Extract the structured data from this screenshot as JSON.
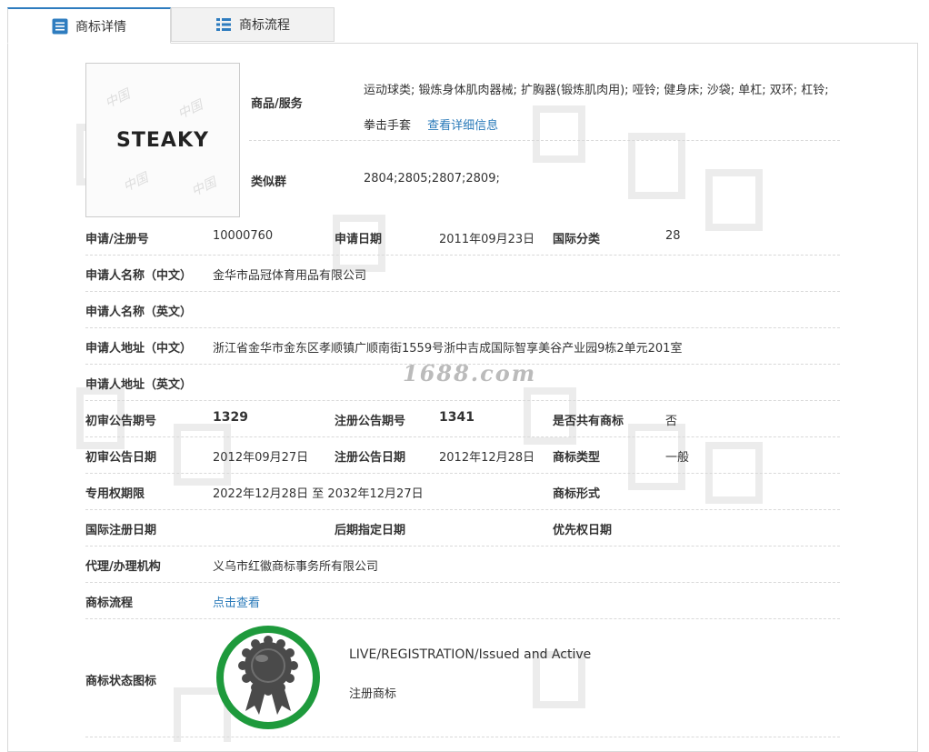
{
  "tabs": [
    {
      "label": "商标详情",
      "icon": "list-icon",
      "active": true
    },
    {
      "label": "商标流程",
      "icon": "grid-list-icon",
      "active": false
    }
  ],
  "logo": {
    "text": "STEAKY"
  },
  "goods": {
    "label": "商品/服务",
    "text": "运动球类; 锻炼身体肌肉器械; 扩胸器(锻炼肌肉用); 哑铃; 健身床; 沙袋; 单杠; 双环; 杠铃; 拳击手套",
    "link": "查看详细信息"
  },
  "similar_group": {
    "label": "类似群",
    "value": "2804;2805;2807;2809;"
  },
  "rows": {
    "reg_no": {
      "label": "申请/注册号",
      "value": "10000760"
    },
    "apply_date": {
      "label": "申请日期",
      "value": "2011年09月23日"
    },
    "intl_class": {
      "label": "国际分类",
      "value": "28"
    },
    "applicant_cn": {
      "label": "申请人名称（中文）",
      "value": "金华市品冠体育用品有限公司"
    },
    "applicant_en": {
      "label": "申请人名称（英文）",
      "value": ""
    },
    "address_cn": {
      "label": "申请人地址（中文）",
      "value": "浙江省金华市金东区孝顺镇广顺南街1559号浙中吉成国际智享美谷产业园9栋2单元201室"
    },
    "address_en": {
      "label": "申请人地址（英文）",
      "value": ""
    },
    "prelim_no": {
      "label": "初审公告期号",
      "value": "1329"
    },
    "reg_pub_no": {
      "label": "注册公告期号",
      "value": "1341"
    },
    "shared": {
      "label": "是否共有商标",
      "value": "否"
    },
    "prelim_date": {
      "label": "初审公告日期",
      "value": "2012年09月27日"
    },
    "reg_pub_date": {
      "label": "注册公告日期",
      "value": "2012年12月28日"
    },
    "tm_type": {
      "label": "商标类型",
      "value": "一般"
    },
    "exclusive": {
      "label": "专用权期限",
      "value": "2022年12月28日 至 2032年12月27日"
    },
    "tm_form": {
      "label": "商标形式",
      "value": ""
    },
    "intl_reg_date": {
      "label": "国际注册日期",
      "value": ""
    },
    "later_date": {
      "label": "后期指定日期",
      "value": ""
    },
    "priority_date": {
      "label": "优先权日期",
      "value": ""
    },
    "agent": {
      "label": "代理/办理机构",
      "value": "义乌市红徽商标事务所有限公司"
    },
    "flow": {
      "label": "商标流程",
      "link": "点击查看"
    }
  },
  "status": {
    "label": "商标状态图标",
    "line1": "LIVE/REGISTRATION/Issued and Active",
    "line2": "注册商标",
    "badge_icon": "award-ribbon-icon",
    "ring_color": "#1e9a3c"
  },
  "watermark": {
    "site": "1688.com"
  }
}
